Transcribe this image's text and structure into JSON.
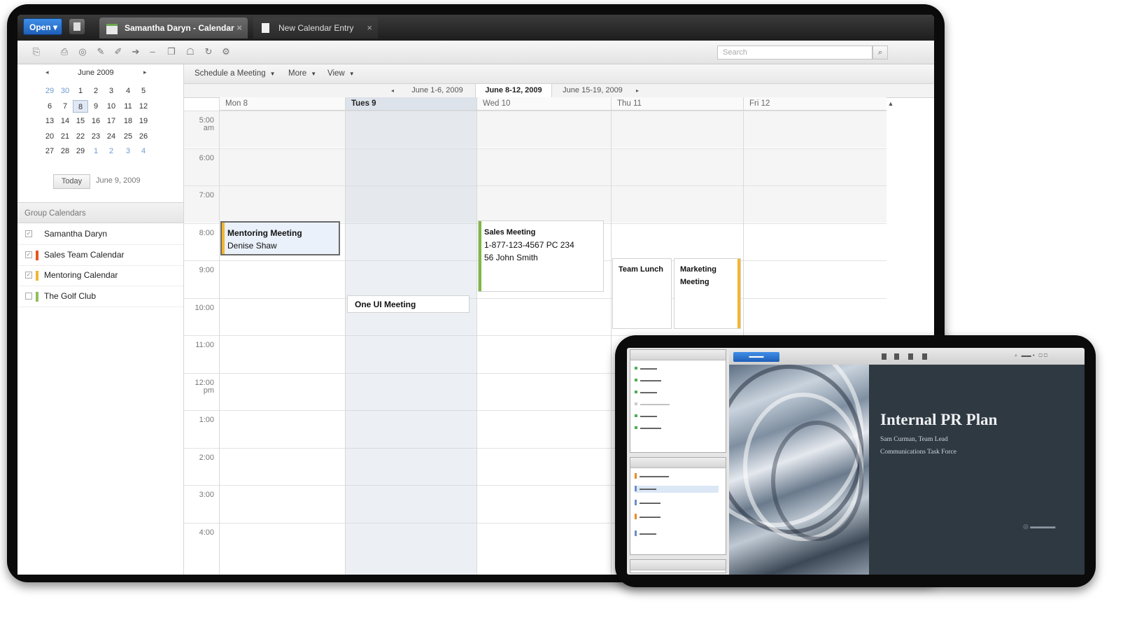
{
  "app": {
    "open_button": "Open",
    "tabs": [
      {
        "label": "Samantha Daryn - Calendar",
        "close": "×"
      },
      {
        "label": "New Calendar Entry",
        "close": "×"
      }
    ],
    "search": {
      "placeholder": "Search"
    }
  },
  "mini_calendar": {
    "month": "June 2009",
    "prev": "◂",
    "next": "▸",
    "weeks": [
      [
        "29",
        "30",
        "1",
        "2",
        "3",
        "4",
        "5"
      ],
      [
        "6",
        "7",
        "8",
        "9",
        "10",
        "11",
        "12"
      ],
      [
        "13",
        "14",
        "15",
        "16",
        "17",
        "18",
        "19"
      ],
      [
        "20",
        "21",
        "22",
        "23",
        "24",
        "25",
        "26"
      ],
      [
        "27",
        "28",
        "29",
        "1",
        "2",
        "3",
        "4"
      ]
    ],
    "selected_day": "8",
    "today_button": "Today",
    "today_date": "June 9, 2009"
  },
  "group_calendars": {
    "header": "Group Calendars",
    "items": [
      {
        "label": "Samantha Daryn",
        "color": "",
        "checked": "✓"
      },
      {
        "label": "Sales Team Calendar",
        "color": "#e8541e",
        "checked": "✓"
      },
      {
        "label": "Mentoring Calendar",
        "color": "#f2b632",
        "checked": "✓"
      },
      {
        "label": "The Golf Club",
        "color": "#8fbf5a",
        "checked": ""
      }
    ]
  },
  "calendar": {
    "toolbar": {
      "schedule": "Schedule a Meeting",
      "more": "More",
      "view": "View"
    },
    "weeks": {
      "prev": "June 1-6, 2009",
      "current": "June 8-12, 2009",
      "next": "June 15-19, 2009"
    },
    "days": [
      "Mon 8",
      "Tues 9",
      "Wed 10",
      "Thu 11",
      "Fri 12"
    ],
    "hours": [
      {
        "h": "5:00",
        "s": "am"
      },
      {
        "h": "6:00",
        "s": ""
      },
      {
        "h": "7:00",
        "s": ""
      },
      {
        "h": "8:00",
        "s": ""
      },
      {
        "h": "9:00",
        "s": ""
      },
      {
        "h": "10:00",
        "s": ""
      },
      {
        "h": "11:00",
        "s": ""
      },
      {
        "h": "12:00",
        "s": "pm"
      },
      {
        "h": "1:00",
        "s": ""
      },
      {
        "h": "2:00",
        "s": ""
      },
      {
        "h": "3:00",
        "s": ""
      },
      {
        "h": "4:00",
        "s": ""
      }
    ],
    "events": {
      "mentoring": {
        "title": "Mentoring Meeting",
        "line2": "Denise Shaw"
      },
      "one_ui": {
        "title": "One UI Meeting"
      },
      "sales": {
        "title": "Sales Meeting",
        "line2": "1-877-123-4567 PC 234",
        "line3": "56 John Smith"
      },
      "team_lunch": {
        "title": "Team Lunch"
      },
      "marketing": {
        "title": "Marketing",
        "line2": "Meeting"
      }
    }
  },
  "meeting_screen": {
    "slide_title": "Internal PR Plan",
    "slide_sub1": "Sam Curman, Team Lead",
    "slide_sub2": "Communications Task Force"
  },
  "colors": {
    "accent": "#2a6fd1",
    "sales": "#7fb842",
    "marketing": "#f2b632",
    "mentoring": "#f2b632"
  }
}
